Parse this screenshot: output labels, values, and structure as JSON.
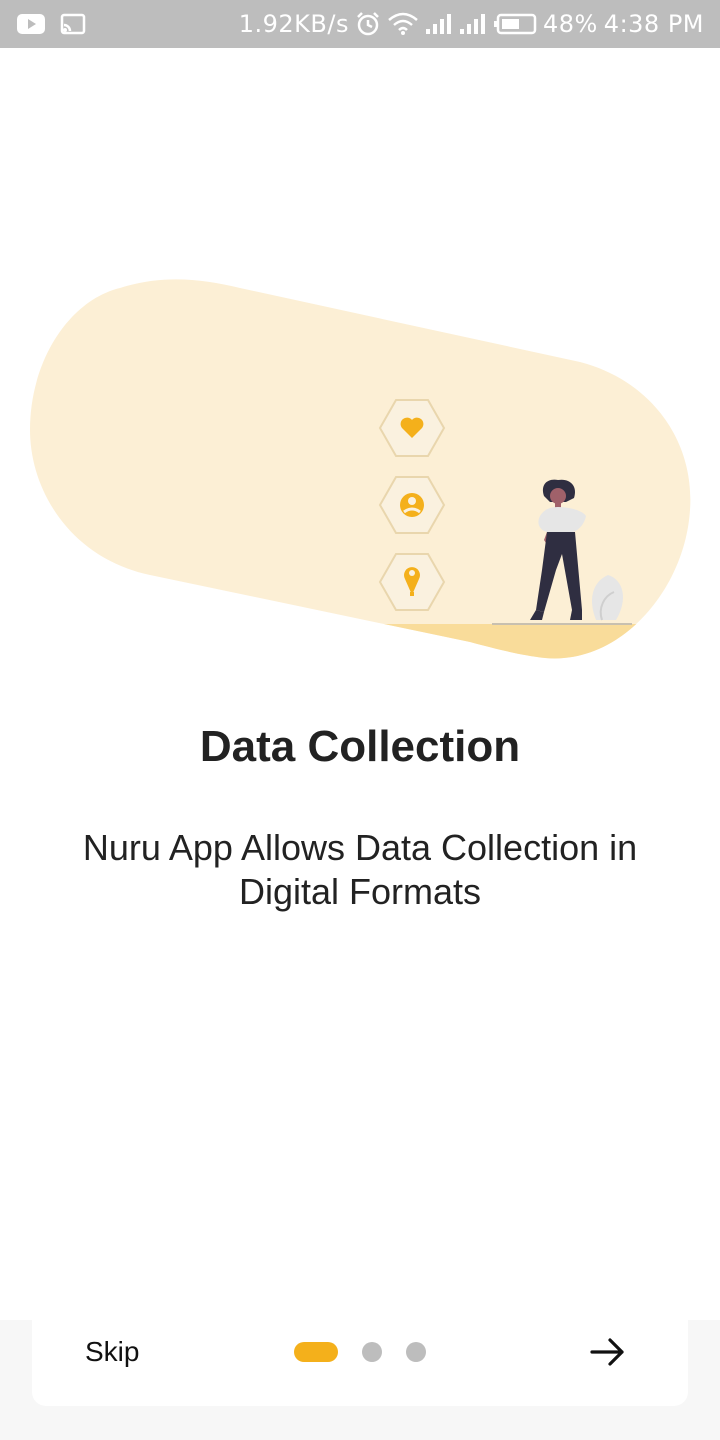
{
  "status_bar": {
    "network_speed": "1.92KB/s",
    "battery_percent": "48%",
    "time": "4:38 PM",
    "icons": [
      "youtube-icon",
      "cast-icon",
      "alarm-icon",
      "wifi-icon",
      "signal-icon",
      "signal-icon",
      "battery-icon"
    ]
  },
  "onboarding": {
    "title": "Data Collection",
    "description": "Nuru App Allows Data Collection in Digital Formats",
    "illustration_icons": [
      "heart-icon",
      "user-icon",
      "location-pin-icon"
    ],
    "total_pages": 3,
    "current_page": 1
  },
  "navigation": {
    "skip_label": "Skip",
    "next_icon": "arrow-right-icon"
  },
  "colors": {
    "accent": "#f4b01b",
    "blob": "#fcefd5",
    "ground": "#f9dc9a",
    "dot_inactive": "#bdbdbd",
    "status_bar": "#bdbdbd"
  }
}
